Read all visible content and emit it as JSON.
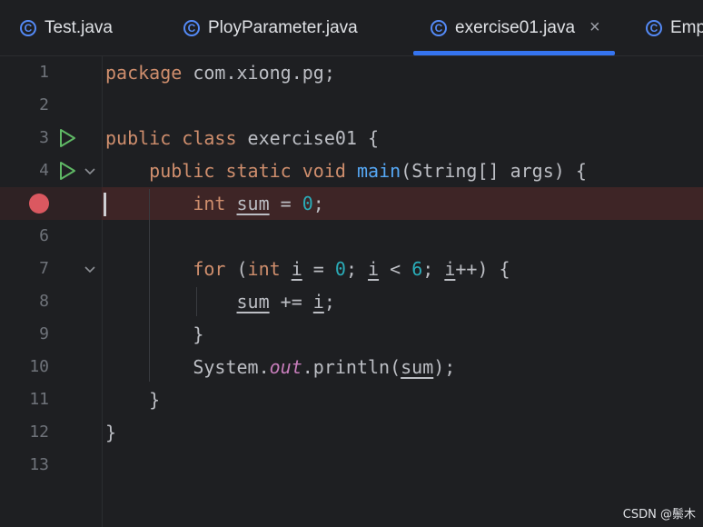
{
  "tabs": [
    {
      "label": "Test.java",
      "icon": "class-icon",
      "active": false
    },
    {
      "label": "PloyParameter.java",
      "icon": "class-icon",
      "active": false
    },
    {
      "label": "exercise01.java",
      "icon": "class-icon",
      "active": true,
      "close": "×"
    },
    {
      "label": "Emp",
      "icon": "class-icon",
      "active": false
    }
  ],
  "class_icon_letter": "C",
  "editor": {
    "breakpoint_line": 5,
    "lines": [
      {
        "n": "1",
        "tokens": [
          [
            "kw",
            "package"
          ],
          [
            "t",
            " com.xiong.pg;"
          ]
        ]
      },
      {
        "n": "2",
        "tokens": []
      },
      {
        "n": "3",
        "tokens": [
          [
            "kw",
            "public"
          ],
          [
            "t",
            " "
          ],
          [
            "kw",
            "class"
          ],
          [
            "t",
            " exercise01 {"
          ]
        ],
        "run": true
      },
      {
        "n": "4",
        "tokens": [
          [
            "t",
            "    "
          ],
          [
            "kw",
            "public"
          ],
          [
            "t",
            " "
          ],
          [
            "kw",
            "static"
          ],
          [
            "t",
            " "
          ],
          [
            "kw",
            "void"
          ],
          [
            "t",
            " "
          ],
          [
            "fn",
            "main"
          ],
          [
            "t",
            "(String[] args) {"
          ]
        ],
        "run": true,
        "fold": true
      },
      {
        "n": "5",
        "tokens": [
          [
            "t",
            "        "
          ],
          [
            "kw",
            "int"
          ],
          [
            "t",
            " "
          ],
          [
            "ul",
            "sum"
          ],
          [
            "t",
            " = "
          ],
          [
            "num",
            "0"
          ],
          [
            "t",
            ";"
          ]
        ]
      },
      {
        "n": "6",
        "tokens": []
      },
      {
        "n": "7",
        "tokens": [
          [
            "t",
            "        "
          ],
          [
            "kw",
            "for"
          ],
          [
            "t",
            " ("
          ],
          [
            "kw",
            "int"
          ],
          [
            "t",
            " "
          ],
          [
            "ul",
            "i"
          ],
          [
            "t",
            " = "
          ],
          [
            "num",
            "0"
          ],
          [
            "t",
            "; "
          ],
          [
            "ul",
            "i"
          ],
          [
            "t",
            " < "
          ],
          [
            "num",
            "6"
          ],
          [
            "t",
            "; "
          ],
          [
            "ul",
            "i"
          ],
          [
            "t",
            "++) {"
          ]
        ],
        "fold": true
      },
      {
        "n": "8",
        "tokens": [
          [
            "t",
            "            "
          ],
          [
            "ul",
            "sum"
          ],
          [
            "t",
            " += "
          ],
          [
            "ul",
            "i"
          ],
          [
            "t",
            ";"
          ]
        ]
      },
      {
        "n": "9",
        "tokens": [
          [
            "t",
            "        }"
          ]
        ]
      },
      {
        "n": "10",
        "tokens": [
          [
            "t",
            "        System."
          ],
          [
            "st",
            "out"
          ],
          [
            "t",
            ".println("
          ],
          [
            "ul",
            "sum"
          ],
          [
            "t",
            ");"
          ]
        ]
      },
      {
        "n": "11",
        "tokens": [
          [
            "t",
            "    }"
          ]
        ]
      },
      {
        "n": "12",
        "tokens": [
          [
            "t",
            "}"
          ]
        ]
      },
      {
        "n": "13",
        "tokens": []
      }
    ]
  },
  "watermark": "CSDN @鬃木",
  "colors": {
    "background": "#1e1f22",
    "keyword": "#cf8e6d",
    "number": "#2aacb8",
    "method": "#56a8f5",
    "static_field": "#c77dbb",
    "text": "#bcbec4",
    "breakpoint": "#db5860",
    "breakpoint_line_bg": "#3e2526",
    "active_tab_underline": "#3574f0",
    "run_icon": "#5fb865"
  }
}
